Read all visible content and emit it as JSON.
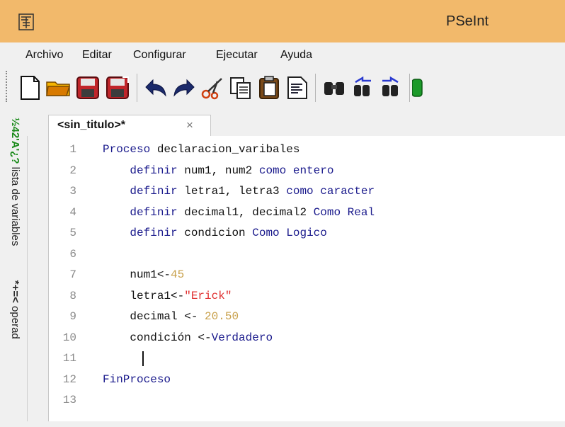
{
  "window": {
    "title": "PSeInt",
    "icon": "pseint-app-icon"
  },
  "menu": [
    "Archivo",
    "Editar",
    "Configurar",
    "Ejecutar",
    "Ayuda"
  ],
  "toolbar": [
    {
      "name": "new-file-icon"
    },
    {
      "name": "open-folder-icon"
    },
    {
      "name": "save-icon"
    },
    {
      "name": "save-as-icon"
    },
    {
      "name": "undo-icon"
    },
    {
      "name": "redo-icon"
    },
    {
      "name": "cut-icon"
    },
    {
      "name": "copy-icon"
    },
    {
      "name": "paste-icon"
    },
    {
      "name": "indent-icon"
    },
    {
      "name": "find-icon"
    },
    {
      "name": "find-previous-icon"
    },
    {
      "name": "find-next-icon"
    },
    {
      "name": "run-icon"
    }
  ],
  "sidebar": {
    "variables_symbol": "½42'A'¿?",
    "variables_label": "lista de variables",
    "operators_symbol": "*+=<",
    "operators_label": "operad"
  },
  "tab": {
    "label": "<sin_titulo>*",
    "close": "×"
  },
  "editor": {
    "lines": [
      {
        "n": "1",
        "tokens": [
          [
            "kw",
            "Proceso"
          ],
          [
            "id",
            " declaracion_varibales"
          ]
        ]
      },
      {
        "n": "2",
        "tokens": [
          [
            "id",
            "    "
          ],
          [
            "kw",
            "definir"
          ],
          [
            "id",
            " num1, num2 "
          ],
          [
            "kw",
            "como entero"
          ]
        ]
      },
      {
        "n": "3",
        "tokens": [
          [
            "id",
            "    "
          ],
          [
            "kw",
            "definir"
          ],
          [
            "id",
            " letra1, letra3 "
          ],
          [
            "kw",
            "como caracter"
          ]
        ]
      },
      {
        "n": "4",
        "tokens": [
          [
            "id",
            "    "
          ],
          [
            "kw",
            "definir"
          ],
          [
            "id",
            " decimal1, decimal2 "
          ],
          [
            "kw",
            "Como Real"
          ]
        ]
      },
      {
        "n": "5",
        "tokens": [
          [
            "id",
            "    "
          ],
          [
            "kw",
            "definir"
          ],
          [
            "id",
            " condicion "
          ],
          [
            "kw",
            "Como Logico"
          ]
        ]
      },
      {
        "n": "6",
        "tokens": []
      },
      {
        "n": "7",
        "tokens": [
          [
            "id",
            "    num1<-"
          ],
          [
            "num",
            "45"
          ]
        ]
      },
      {
        "n": "8",
        "tokens": [
          [
            "id",
            "    letra1<-"
          ],
          [
            "str",
            "\"Erick\""
          ]
        ]
      },
      {
        "n": "9",
        "tokens": [
          [
            "id",
            "    decimal <- "
          ],
          [
            "num",
            "20.50"
          ]
        ]
      },
      {
        "n": "10",
        "tokens": [
          [
            "id",
            "    condición <-"
          ],
          [
            "kw",
            "Verdadero"
          ]
        ]
      },
      {
        "n": "11",
        "tokens": []
      },
      {
        "n": "12",
        "tokens": [
          [
            "kw",
            "FinProceso"
          ]
        ]
      },
      {
        "n": "13",
        "tokens": []
      }
    ]
  },
  "colors": {
    "titlebar": "#f2b96b",
    "keyword": "#1a1a8c",
    "number": "#c8a04b",
    "string": "#e03030",
    "linenum": "#8a8a8a"
  }
}
